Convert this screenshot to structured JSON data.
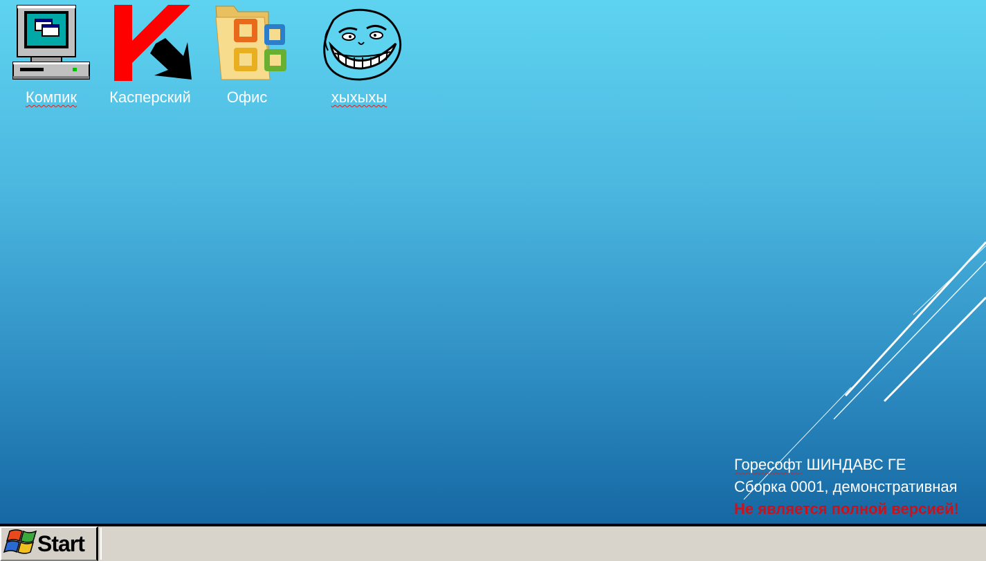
{
  "desktop": {
    "icons": [
      {
        "label": "Компик",
        "icon": "computer-icon",
        "spellcheck_underline": true
      },
      {
        "label": "Касперский",
        "icon": "kaspersky-icon",
        "spellcheck_underline": false
      },
      {
        "label": "Офис",
        "icon": "office-folder-icon",
        "spellcheck_underline": false
      },
      {
        "label": "хыхыхы",
        "icon": "trollface-icon",
        "spellcheck_underline": true
      }
    ],
    "build_info": {
      "line1_part1": "Горесофт",
      "line1_part2": " ШИНДАВС ГЕ",
      "line2": "Сборка 0001, демонстративная",
      "warning": "Не является полной версией!"
    }
  },
  "taskbar": {
    "start_label": "Start"
  },
  "colors": {
    "desktop_top": "#5ed3f0",
    "desktop_bottom": "#1668a3",
    "warning_text": "#c8121c",
    "taskbar": "#d8d4cc"
  }
}
